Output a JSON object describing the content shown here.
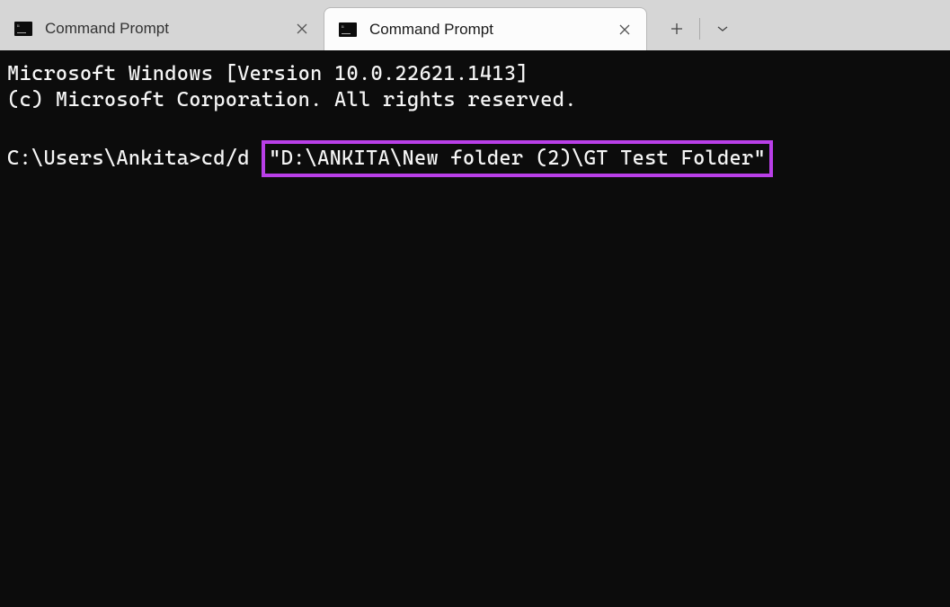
{
  "tabs": [
    {
      "title": "Command Prompt",
      "active": false
    },
    {
      "title": "Command Prompt",
      "active": true
    }
  ],
  "terminal": {
    "line1": "Microsoft Windows [Version 10.0.22621.1413]",
    "line2": "(c) Microsoft Corporation. All rights reserved.",
    "prompt_prefix": "C:\\Users\\Ankita>cd/d ",
    "highlighted_path": "\"D:\\ANKITA\\New folder (2)\\GT Test Folder\""
  }
}
